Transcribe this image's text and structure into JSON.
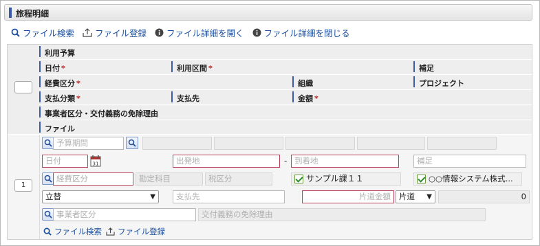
{
  "section": {
    "title": "旅程明細"
  },
  "toolbar": {
    "file_search": "ファイル検索",
    "file_register": "ファイル登録",
    "open_file_details": "ファイル詳細を開く",
    "close_file_details": "ファイル詳細を閉じる"
  },
  "header": {
    "budget": "利用予算",
    "date": "日付",
    "usage_section": "利用区間",
    "supplement": "補足",
    "expense_category": "経費区分",
    "organization": "組織",
    "project": "プロジェクト",
    "payment_type": "支払分類",
    "payee": "支払先",
    "amount": "金額",
    "business_category": "事業者区分・交付義務の免除理由",
    "file": "ファイル",
    "required_mark": "*"
  },
  "row": {
    "number": "1",
    "budget_period_placeholder": "予算期間",
    "date_placeholder": "日付",
    "departure_placeholder": "出発地",
    "range_separator": "-",
    "arrival_placeholder": "到着地",
    "supplement_placeholder": "補足",
    "expense_category_placeholder": "経費区分",
    "account_item_placeholder": "勘定科目",
    "tax_category_placeholder": "税区分",
    "organization_value": "サンプル課１１",
    "project_value": "○○情報システム株式...",
    "payment_type_value": "立替",
    "payee_placeholder": "支払先",
    "one_way_fare_placeholder": "片道金額",
    "trip_type_value": "片道",
    "amount_value": "0",
    "business_category_placeholder": "事業者区分",
    "exemption_reason_placeholder": "交付義務の免除理由",
    "file_search": "ファイル検索",
    "file_register": "ファイル登録"
  },
  "colors": {
    "accent": "#3a5aa8",
    "link": "#1a4fa0",
    "required": "#c02020"
  }
}
